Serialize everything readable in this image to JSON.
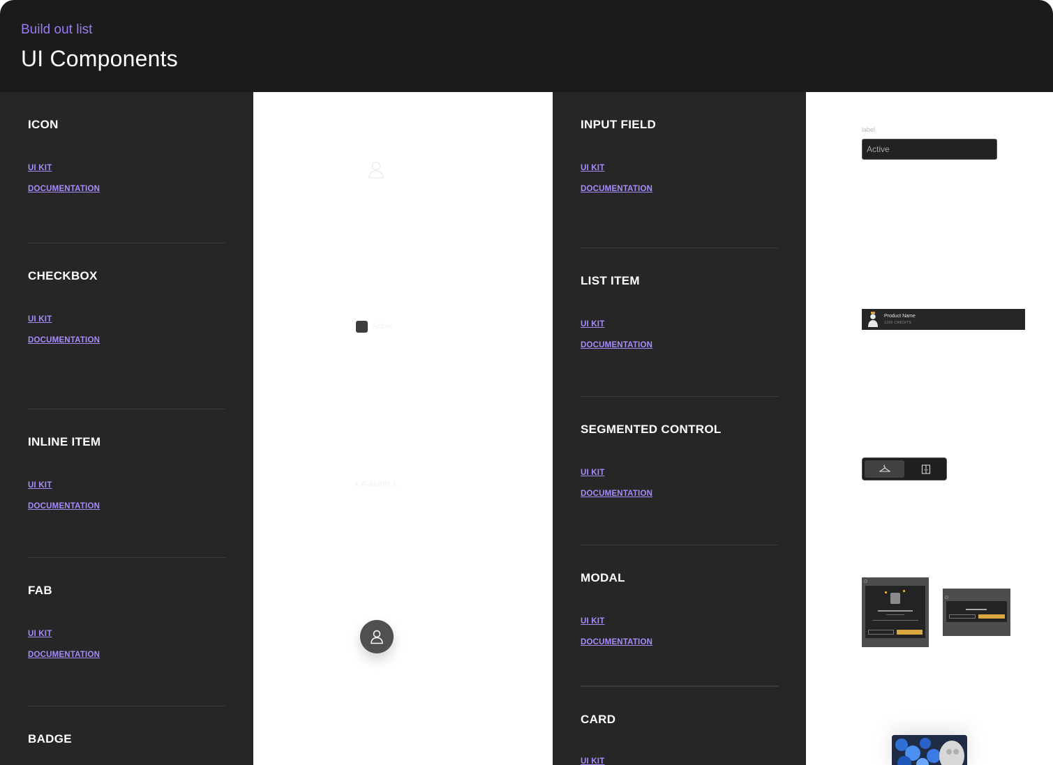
{
  "header": {
    "eyebrow": "Build out list",
    "title": "UI Components"
  },
  "colors": {
    "accent": "#a78bfa",
    "header_bg": "#1b1b1c",
    "panel_bg": "#262626",
    "modal_button": "#d9a640"
  },
  "left_sections": [
    {
      "title": "ICON",
      "uikit": "UI KIT",
      "docs": "DOCUMENTATION"
    },
    {
      "title": "CHECKBOX",
      "uikit": "UI KIT",
      "docs": "DOCUMENTATION"
    },
    {
      "title": "INLINE ITEM",
      "uikit": "UI KIT",
      "docs": "DOCUMENTATION"
    },
    {
      "title": "FAB",
      "uikit": "UI KIT",
      "docs": "DOCUMENTATION"
    },
    {
      "title": "BADGE"
    }
  ],
  "right_sections": [
    {
      "title": "INPUT FIELD",
      "uikit": "UI KIT",
      "docs": "DOCUMENTATION"
    },
    {
      "title": "LIST ITEM",
      "uikit": "UI KIT",
      "docs": "DOCUMENTATION"
    },
    {
      "title": "SEGMENTED CONTROL",
      "uikit": "UI KIT",
      "docs": "DOCUMENTATION"
    },
    {
      "title": "MODAL",
      "uikit": "UI KIT",
      "docs": "DOCUMENTATION"
    },
    {
      "title": "CARD",
      "uikit": "UI KIT"
    }
  ],
  "previews": {
    "checkbox_label": "Active",
    "inline_item_text": "A-worth",
    "input_field": {
      "label": "label",
      "value": "Active"
    },
    "list_item": {
      "name": "Product Name",
      "credits": "1200 CREDITS"
    },
    "segmented_icons": [
      "hanger-icon",
      "wardrobe-icon"
    ],
    "fab_icon": "person-icon",
    "icon_preview": "person-icon"
  }
}
